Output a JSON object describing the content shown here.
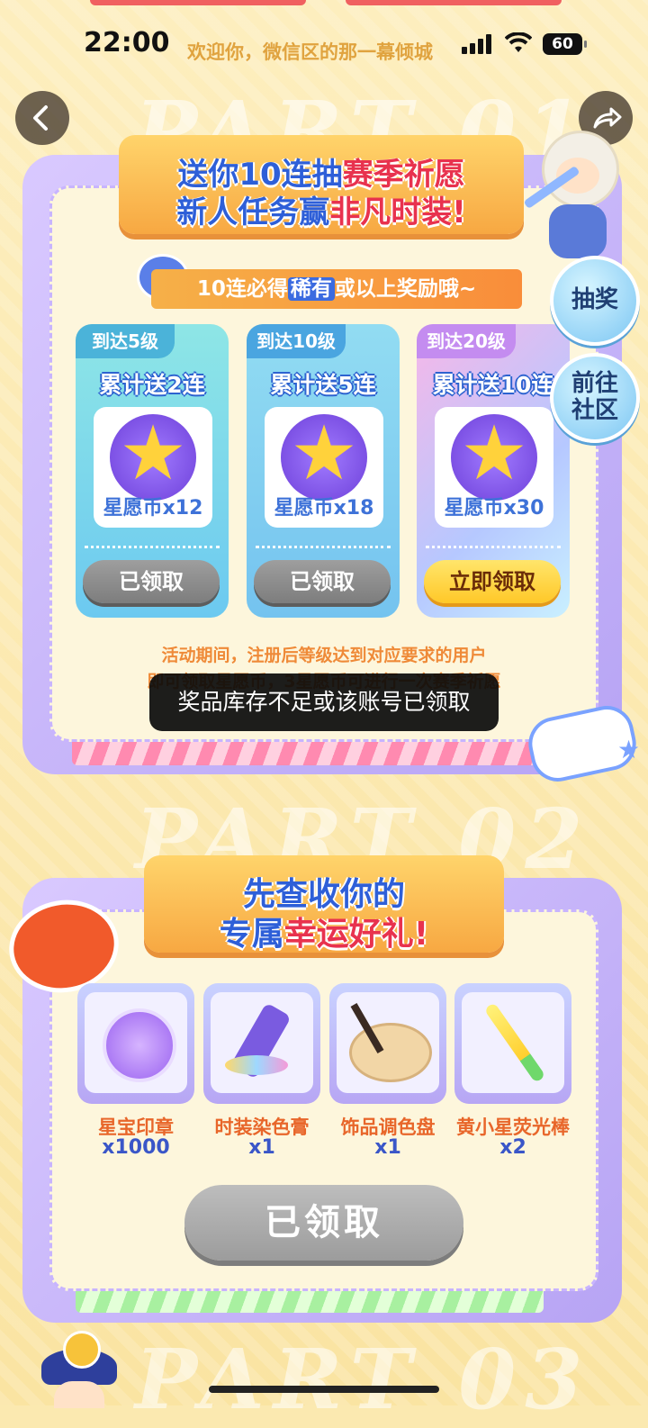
{
  "status": {
    "time": "22:00",
    "marquee": "欢迎你，微信区的那一幕倾城",
    "battery": "60"
  },
  "nav": {
    "back_icon": "chevron-left-icon",
    "share_icon": "share-icon"
  },
  "part1": {
    "watermark": "PART 01",
    "ribbon_line1_a": "送你10连抽",
    "ribbon_line1_b": "赛季祈愿",
    "ribbon_line2_a": "新人任务赢",
    "ribbon_line2_b": "非凡时装!",
    "notice_a": "10连必得",
    "notice_rare": "稀有",
    "notice_b": "或以上奖励哦~",
    "tiers": [
      {
        "level": "到达5级",
        "gift": "累计送2连",
        "reward": "星愿币x12",
        "button": "已领取",
        "state": "claimed"
      },
      {
        "level": "到达10级",
        "gift": "累计送5连",
        "reward": "星愿币x18",
        "button": "已领取",
        "state": "claimed"
      },
      {
        "level": "到达20级",
        "gift": "累计送10连",
        "reward": "星愿币x30",
        "button": "立即领取",
        "state": "available"
      }
    ],
    "desc_line1": "活动期间，注册后等级达到对应要求的用户",
    "desc_line2": "即可领取星愿币，3星愿币可进行一次赛季祈愿"
  },
  "side": {
    "draw": "抽奖",
    "community_1": "前往",
    "community_2": "社区"
  },
  "toast": "奖品库存不足或该账号已领取",
  "part2": {
    "watermark": "PART 02",
    "ribbon_line1": "先查收你的",
    "ribbon_line2_a": "专属",
    "ribbon_line2_b": "幸运好礼!",
    "items": [
      {
        "name": "星宝印章",
        "qty": "x1000"
      },
      {
        "name": "时装染色膏",
        "qty": "x1"
      },
      {
        "name": "饰品调色盘",
        "qty": "x1"
      },
      {
        "name": "黄小星荧光棒",
        "qty": "x2"
      }
    ],
    "button": "已领取"
  },
  "part3": {
    "watermark": "PART 03"
  },
  "colors": {
    "accent_orange": "#f7a842",
    "accent_blue": "#2e5fd8",
    "accent_red": "#e8324e",
    "card_purple": "#b7a4f4"
  }
}
